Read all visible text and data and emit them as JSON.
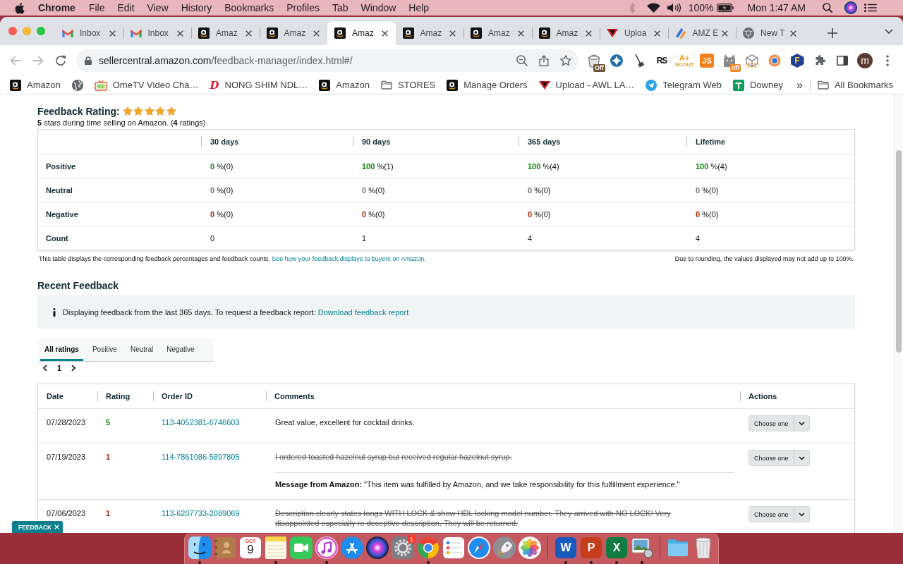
{
  "menu_bar": {
    "app": "Chrome",
    "menus": [
      "File",
      "Edit",
      "View",
      "History",
      "Bookmarks",
      "Profiles",
      "Tab",
      "Window",
      "Help"
    ],
    "battery": "100%",
    "clock": "Mon 1:47 AM"
  },
  "tabs": [
    {
      "kind": "mail",
      "title": "Inbox",
      "selected": false
    },
    {
      "kind": "mail",
      "title": "Inbox",
      "selected": false
    },
    {
      "kind": "shop",
      "title": "Amaz",
      "selected": false
    },
    {
      "kind": "shop",
      "title": "Amaz",
      "selected": false
    },
    {
      "kind": "shop",
      "title": "Amaz",
      "selected": true
    },
    {
      "kind": "shop",
      "title": "Amaz",
      "selected": false
    },
    {
      "kind": "shop",
      "title": "Amaz",
      "selected": false
    },
    {
      "kind": "shop",
      "title": "Amaz",
      "selected": false
    },
    {
      "kind": "upload",
      "title": "Uploa",
      "selected": false
    },
    {
      "kind": "tool",
      "title": "AMZ E",
      "selected": false
    },
    {
      "kind": "newtab",
      "title": "New T",
      "selected": false
    }
  ],
  "address": {
    "host": "sellercentral.amazon.com",
    "path": "/feedback-manager/index.html#/"
  },
  "extensions": [
    {
      "kind": "bucket",
      "badge": "Off"
    },
    {
      "kind": "shield"
    },
    {
      "kind": "broom"
    },
    {
      "kind": "monogram",
      "label": "RS"
    },
    {
      "kind": "scout",
      "label": "A+",
      "sublabel": "SCOUT"
    },
    {
      "kind": "tile",
      "label": "JS"
    },
    {
      "kind": "cat",
      "badge": "off"
    },
    {
      "kind": "cube"
    },
    {
      "kind": "orb"
    },
    {
      "kind": "hexagon",
      "label": "F"
    }
  ],
  "profile": "m",
  "bookmarks": [
    {
      "kind": "shop",
      "label": "Amazon"
    },
    {
      "kind": "web"
    },
    {
      "kind": "video",
      "label": "OmeTV Video Cha…"
    },
    {
      "kind": "letter",
      "glyph": "D",
      "label": "NONG SHIM NDL…"
    },
    {
      "kind": "shop",
      "label": "Amazon"
    },
    {
      "kind": "folder",
      "label": "STORES"
    },
    {
      "kind": "shop",
      "label": "Manage Orders"
    },
    {
      "kind": "upload",
      "label": "Upload - AWL LA…"
    },
    {
      "kind": "chat",
      "label": "Telegram Web"
    },
    {
      "kind": "sheet",
      "label": "Downey"
    }
  ],
  "bookmarks_overflow": "»",
  "all_bookmarks": "All Bookmarks",
  "rating": {
    "title": "Feedback Rating:",
    "stars": 5,
    "summary": "**5** stars during time selling on Amazon. (**4** ratings)"
  },
  "summary_table": {
    "columns": [
      "30 days",
      "90 days",
      "365 days",
      "Lifetime"
    ],
    "rows": [
      {
        "kind": "positive",
        "label": "Positive",
        "cells": [
          "**0** %(0)",
          "**100** %(1)",
          "**100** %(4)",
          "**100** %(4)"
        ]
      },
      {
        "kind": "neutral",
        "label": "Neutral",
        "cells": [
          "**0** %(0)",
          "**0** %(0)",
          "**0** %(0)",
          "**0** %(0)"
        ]
      },
      {
        "kind": "negative",
        "label": "Negative",
        "cells": [
          "**0** %(0)",
          "**0** %(0)",
          "**0** %(0)",
          "**0** %(0)"
        ]
      },
      {
        "kind": "count",
        "label": "Count",
        "cells": [
          "0",
          "1",
          "4",
          "4"
        ]
      }
    ],
    "note": "This table displays the corresponding feedback percentages and feedback counts.",
    "note_link": "See how your feedback displays to buyers on Amazon.",
    "rounding_note": "Due to rounding, the values displayed may not add up to 100%."
  },
  "recent": {
    "title": "Recent Feedback",
    "info": "Displaying feedback from the last 365 days. To request a feedback report:",
    "info_link": "Download feedback report",
    "tabs": [
      {
        "label": "All ratings",
        "selected": true
      },
      {
        "label": "Positive",
        "selected": false
      },
      {
        "label": "Neutral",
        "selected": false
      },
      {
        "label": "Negative",
        "selected": false
      }
    ],
    "page": "1",
    "columns": [
      "Date",
      "Rating",
      "Order ID",
      "Comments",
      "Actions"
    ],
    "rows": [
      {
        "kind": "positive",
        "date": "07/28/2023",
        "rating": "5",
        "order_id": "113-4052381-6746603",
        "comment": "Great value, excellent for cocktail drinks.",
        "struck": false,
        "action": "Choose one"
      },
      {
        "kind": "negative",
        "date": "07/19/2023",
        "rating": "1",
        "order_id": "114-7861086-5897805",
        "comment": "I ordered toasted hazelnut syrup but received regular hazelnut syrup.",
        "struck": true,
        "amazon_message": "**Message from Amazon:** \"This item was fulfilled by Amazon, and we take responsibility for this fulfillment experience.\"",
        "action": "Choose one"
      },
      {
        "kind": "negative",
        "date": "07/06/2023",
        "rating": "1",
        "order_id": "113-6207733-2089069",
        "comment": "Description clearly states tongs WITH LOCK & show HDL locking model number. They arrived with NO LOCK! Very disappointed especially re deceptive description. They will be returned.",
        "struck": true,
        "action": "Choose one"
      }
    ]
  },
  "feedback_button": "FEEDBACK",
  "dock": [
    {
      "kind": "finder",
      "running": true
    },
    {
      "kind": "contacts",
      "running": false
    },
    {
      "kind": "calendar",
      "month": "OCT",
      "day": "9",
      "running": false
    },
    {
      "kind": "notes",
      "running": true
    },
    {
      "kind": "facetime",
      "running": false
    },
    {
      "kind": "music",
      "running": true
    },
    {
      "kind": "store",
      "running": false
    },
    {
      "kind": "siri",
      "running": false
    },
    {
      "kind": "settings",
      "badge": "1",
      "running": false
    },
    {
      "kind": "chrome",
      "running": true
    },
    {
      "kind": "reminders",
      "running": false
    },
    {
      "kind": "safari",
      "running": false
    },
    {
      "kind": "rocket",
      "running": false
    },
    {
      "kind": "photos",
      "running": false
    },
    {
      "kind": "divider"
    },
    {
      "kind": "letter",
      "letter": "W",
      "color": "#185abd",
      "running": true
    },
    {
      "kind": "letter",
      "letter": "P",
      "color": "#c43e1c",
      "running": true
    },
    {
      "kind": "letter",
      "letter": "X",
      "color": "#107c41",
      "running": true
    },
    {
      "kind": "preview",
      "running": true
    },
    {
      "kind": "divider"
    },
    {
      "kind": "folder",
      "running": false
    },
    {
      "kind": "trash",
      "running": false
    }
  ]
}
